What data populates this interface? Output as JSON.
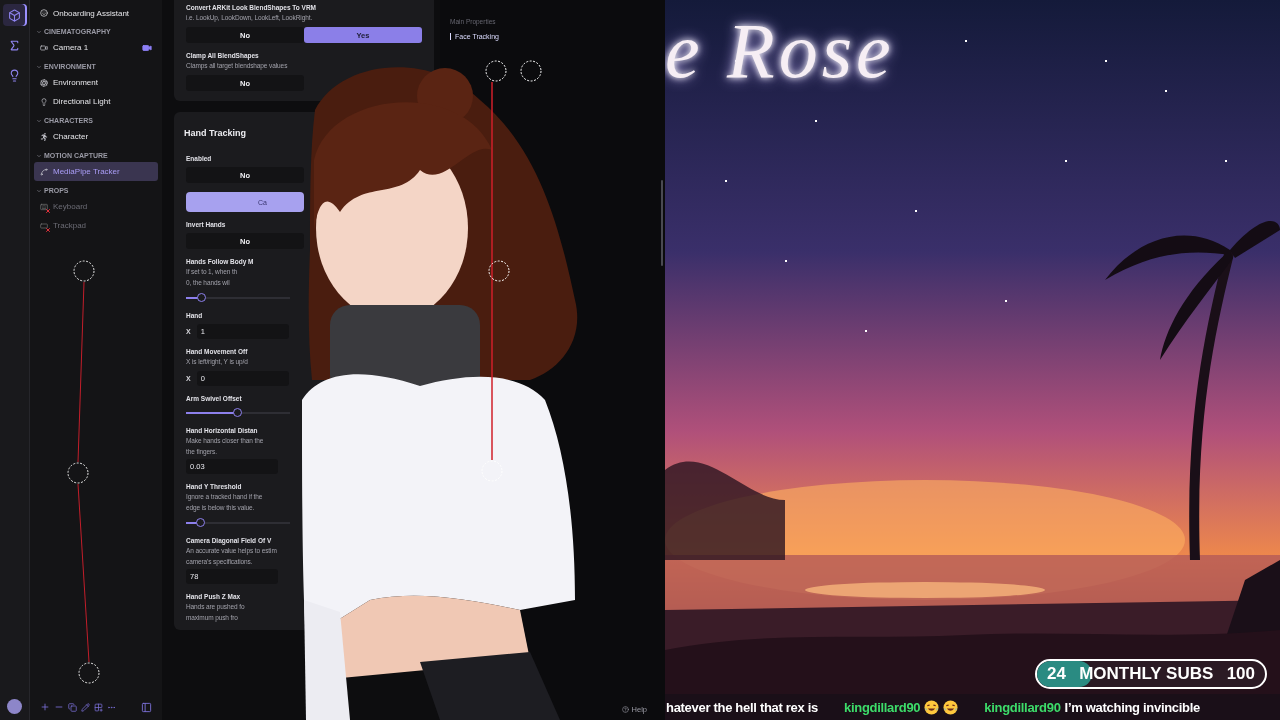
{
  "rail": {
    "icons": [
      {
        "kind": "cube",
        "selected": true
      },
      {
        "kind": "sigma",
        "selected": false
      },
      {
        "kind": "bulb",
        "selected": false
      }
    ]
  },
  "sidebar": {
    "top_item": {
      "label": "Onboarding Assistant"
    },
    "sections": [
      {
        "title": "CINEMATOGRAPHY",
        "expanded": true,
        "children": [
          {
            "label": "Camera 1",
            "kind": "camera",
            "selected": false,
            "disabled": false,
            "live": true
          }
        ]
      },
      {
        "title": "ENVIRONMENT",
        "expanded": true,
        "children": [
          {
            "label": "Environment",
            "kind": "environment",
            "selected": false,
            "disabled": false,
            "live": false
          },
          {
            "label": "Directional Light",
            "kind": "light",
            "selected": false,
            "disabled": false,
            "live": false
          }
        ]
      },
      {
        "title": "CHARACTERS",
        "expanded": true,
        "children": [
          {
            "label": "Character",
            "kind": "character",
            "selected": false,
            "disabled": false,
            "live": false
          }
        ]
      },
      {
        "title": "MOTION CAPTURE",
        "expanded": true,
        "children": [
          {
            "label": "MediaPipe Tracker",
            "kind": "tracker",
            "selected": true,
            "disabled": false,
            "live": false
          }
        ]
      },
      {
        "title": "PROPS",
        "expanded": true,
        "children": [
          {
            "label": "Keyboard",
            "kind": "keyboard",
            "selected": false,
            "disabled": true,
            "live": false
          },
          {
            "label": "Trackpad",
            "kind": "trackpad",
            "selected": false,
            "disabled": true,
            "live": false
          }
        ]
      }
    ]
  },
  "settings": {
    "cards": [
      {
        "items": [
          {
            "kind": "toggle",
            "label": "Convert ARKit Look BlendShapes To VRM",
            "description": [
              "i.e. LookUp, LookDown, LookLeft, LookRight."
            ],
            "options": [
              {
                "label": "No",
                "selected": false
              },
              {
                "label": "Yes",
                "selected": true
              }
            ]
          },
          {
            "kind": "toggle",
            "label": "Clamp All BlendShapes",
            "description": [
              "Clamps all target blendshape values"
            ],
            "options": [
              {
                "label": "No",
                "selected": false
              }
            ]
          }
        ]
      },
      {
        "title": "Hand Tracking",
        "items": [
          {
            "kind": "toggle",
            "label": "Enabled",
            "options": [
              {
                "label": "No",
                "selected": false
              }
            ]
          },
          {
            "kind": "button",
            "label": "Ca"
          },
          {
            "kind": "toggle",
            "label": "Invert Hands",
            "options": [
              {
                "label": "No",
                "selected": false
              }
            ]
          },
          {
            "kind": "slider",
            "label": "Hands Follow Body M",
            "description": [
              "If set to 1, when th",
              "0, the hands wil"
            ],
            "level": 0.15
          },
          {
            "kind": "vector",
            "label": "Hand",
            "fields": [
              {
                "axis": "X",
                "value": "1"
              }
            ]
          },
          {
            "kind": "vector",
            "label": "Hand Movement Off",
            "description": [
              "X is left/right, Y is up/d"
            ],
            "fields": [
              {
                "axis": "X",
                "value": "0"
              }
            ]
          },
          {
            "kind": "slider",
            "label": "Arm Swivel Offset",
            "level": 0.5
          },
          {
            "kind": "number",
            "label": "Hand Horizontal Distan",
            "description": [
              "Make hands closer than the",
              "the fingers."
            ],
            "value": "0.03"
          },
          {
            "kind": "slider",
            "label": "Hand Y Threshold",
            "description": [
              "Ignore a tracked hand if the",
              "edge is below this value."
            ],
            "level": 0.14
          },
          {
            "kind": "number",
            "label": "Camera Diagonal Field Of V",
            "description": [
              "An accurate value helps to estim",
              "camera's specifications."
            ],
            "value": "78"
          },
          {
            "kind": "number",
            "label": "Hand Push Z Max",
            "description": [
              "Hands are pushed fo",
              "maximum push fro"
            ]
          }
        ]
      }
    ]
  },
  "properties": {
    "heading": "Main Properties",
    "nav": [
      {
        "label": "Face Tracking",
        "selected": true
      }
    ],
    "help": "Help"
  },
  "stream": {
    "title": "e Rose",
    "subs": {
      "current": "24",
      "label": "MONTHLY SUBS",
      "goal": "100",
      "level": 0.24
    },
    "chat": [
      {
        "kind": "text",
        "message": "hatever the hell that rex is"
      },
      {
        "kind": "emotes",
        "user": "kingdillard90"
      },
      {
        "kind": "text",
        "user": "kingdillard90",
        "message": "I’m watching invincible"
      }
    ]
  }
}
